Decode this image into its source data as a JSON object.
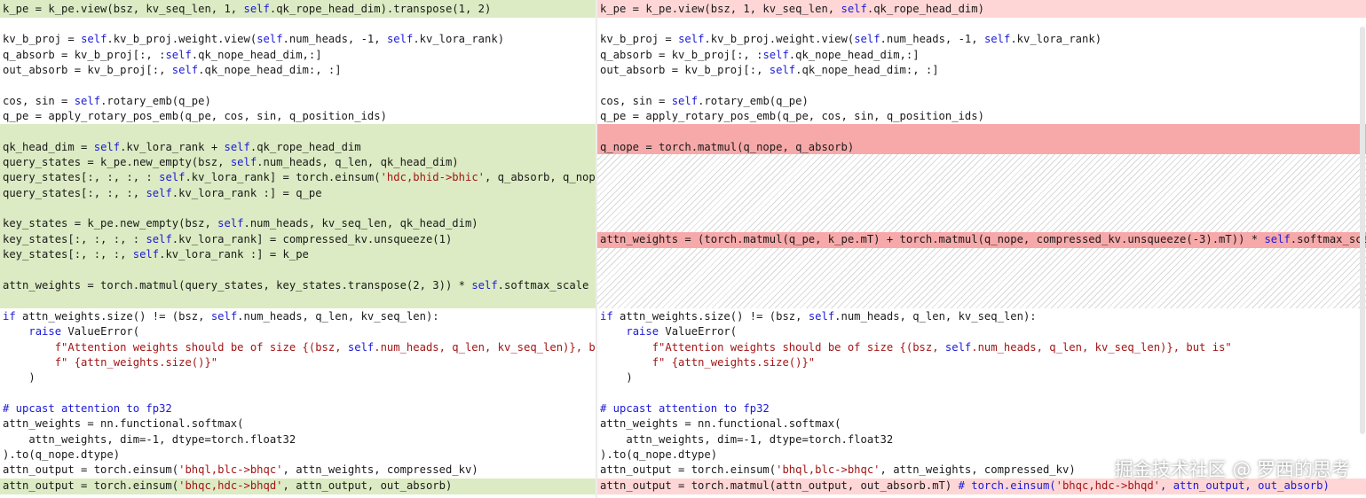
{
  "left_pane": {
    "lines": [
      "k_pe = k_pe.view(bsz, kv_seq_len, 1, self.qk_rope_head_dim).transpose(1, 2)",
      "kv_b_proj = self.kv_b_proj.weight.view(self.num_heads, -1, self.kv_lora_rank)",
      "q_absorb = kv_b_proj[:, :self.qk_nope_head_dim,:]",
      "out_absorb = kv_b_proj[:, self.qk_nope_head_dim:, :]",
      "cos, sin = self.rotary_emb(q_pe)",
      "q_pe = apply_rotary_pos_emb(q_pe, cos, sin, q_position_ids)",
      "qk_head_dim = self.kv_lora_rank + self.qk_rope_head_dim",
      "query_states = k_pe.new_empty(bsz, self.num_heads, q_len, qk_head_dim)",
      "query_states[:, :, :, : self.kv_lora_rank] = torch.einsum('hdc,bhid->bhic', q_absorb, q_nope)",
      "query_states[:, :, :, self.kv_lora_rank :] = q_pe",
      "key_states = k_pe.new_empty(bsz, self.num_heads, kv_seq_len, qk_head_dim)",
      "key_states[:, :, :, : self.kv_lora_rank] = compressed_kv.unsqueeze(1)",
      "key_states[:, :, :, self.kv_lora_rank :] = k_pe",
      "attn_weights = torch.matmul(query_states, key_states.transpose(2, 3)) * self.softmax_scale",
      "if attn_weights.size() != (bsz, self.num_heads, q_len, kv_seq_len):",
      "    raise ValueError(",
      "        f\"Attention weights should be of size {(bsz, self.num_heads, q_len, kv_seq_len)}, but",
      "        f\" {attn_weights.size()}\"",
      "    )",
      "# upcast attention to fp32",
      "attn_weights = nn.functional.softmax(",
      "    attn_weights, dim=-1, dtype=torch.float32",
      ").to(q_nope.dtype)",
      "attn_output = torch.einsum('bhql,blc->bhqc', attn_weights, compressed_kv)",
      "attn_output = torch.einsum('bhqc,hdc->bhqd', attn_output, out_absorb)"
    ]
  },
  "right_pane": {
    "lines": [
      "k_pe = k_pe.view(bsz, 1, kv_seq_len, self.qk_rope_head_dim)",
      "kv_b_proj = self.kv_b_proj.weight.view(self.num_heads, -1, self.kv_lora_rank)",
      "q_absorb = kv_b_proj[:, :self.qk_nope_head_dim,:]",
      "out_absorb = kv_b_proj[:, self.qk_nope_head_dim:, :]",
      "cos, sin = self.rotary_emb(q_pe)",
      "q_pe = apply_rotary_pos_emb(q_pe, cos, sin, q_position_ids)",
      "q_nope = torch.matmul(q_nope, q_absorb)",
      "attn_weights = (torch.matmul(q_pe, k_pe.mT) + torch.matmul(q_nope, compressed_kv.unsqueeze(-3).mT)) * self.softmax_scale",
      "if attn_weights.size() != (bsz, self.num_heads, q_len, kv_seq_len):",
      "    raise ValueError(",
      "        f\"Attention weights should be of size {(bsz, self.num_heads, q_len, kv_seq_len)}, but is\"",
      "        f\" {attn_weights.size()}\"",
      "    )",
      "# upcast attention to fp32",
      "attn_weights = nn.functional.softmax(",
      "    attn_weights, dim=-1, dtype=torch.float32",
      ").to(q_nope.dtype)",
      "attn_output = torch.einsum('bhql,blc->bhqc', attn_weights, compressed_kv)",
      "attn_output = torch.matmul(attn_output, out_absorb.mT) # torch.einsum('bhqc,hdc->bhqd', attn_output, out_absorb)"
    ]
  },
  "watermark": "掘金技术社区 @ 罗西的思考",
  "colors": {
    "added_bg": "#dcebc3",
    "removed_bg": "#ffd6d6",
    "removed_strong_bg": "#f7a9a9",
    "keyword": "#1a1ad6",
    "string": "#a31515"
  }
}
